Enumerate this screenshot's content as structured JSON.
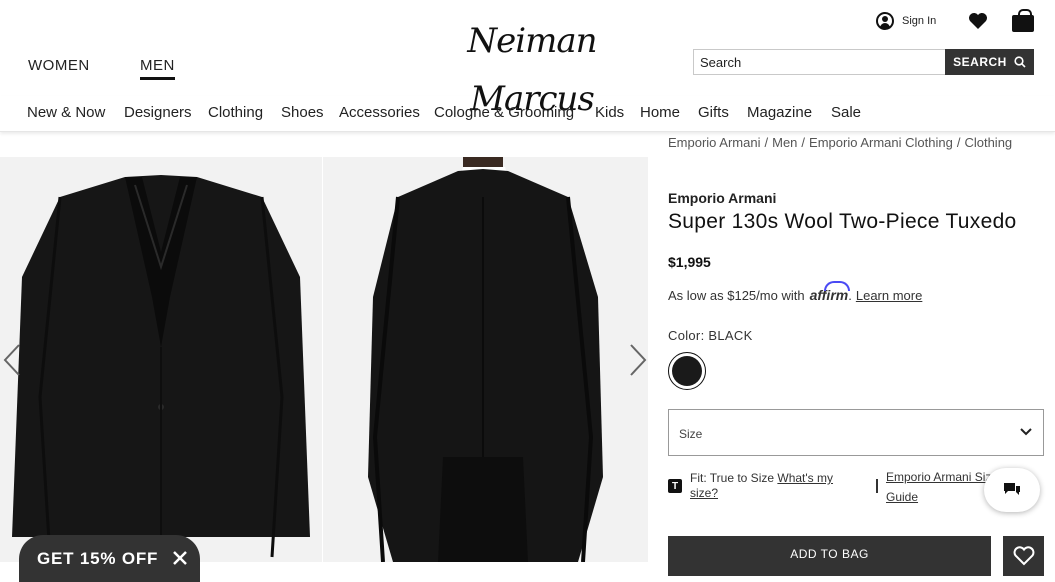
{
  "header": {
    "logo": "Neiman Marcus",
    "gender_tabs": [
      "WOMEN",
      "MEN"
    ],
    "sign_in": "Sign In",
    "search": {
      "placeholder": "Search",
      "button_label": "SEARCH"
    }
  },
  "nav": {
    "categories": [
      "New & Now",
      "Designers",
      "Clothing",
      "Shoes",
      "Accessories",
      "Cologne & Grooming",
      "Kids",
      "Home",
      "Gifts",
      "Magazine",
      "Sale"
    ]
  },
  "breadcrumb": [
    "Emporio Armani",
    "Men",
    "Emporio Armani Clothing",
    "Clothing"
  ],
  "product": {
    "brand": "Emporio Armani",
    "title": "Super 130s Wool Two-Piece Tuxedo",
    "price": "$1,995",
    "affirm_text": "As low as $125/mo with",
    "affirm_logo": "affirm",
    "learn_more": "Learn more",
    "color_label": "Color:",
    "color_value": "BLACK",
    "swatch_color": "#1a1a1a",
    "size_placeholder": "Size",
    "fit_label": "Fit: True to Size",
    "fit_link": "What's my size?",
    "size_guide": "Emporio Armani Size Guide",
    "add_to_bag": "ADD TO BAG"
  },
  "promo": {
    "label": "GET 15% OFF"
  },
  "colors": {
    "dark": "#333333",
    "affirm_blue": "#4a4af4"
  }
}
